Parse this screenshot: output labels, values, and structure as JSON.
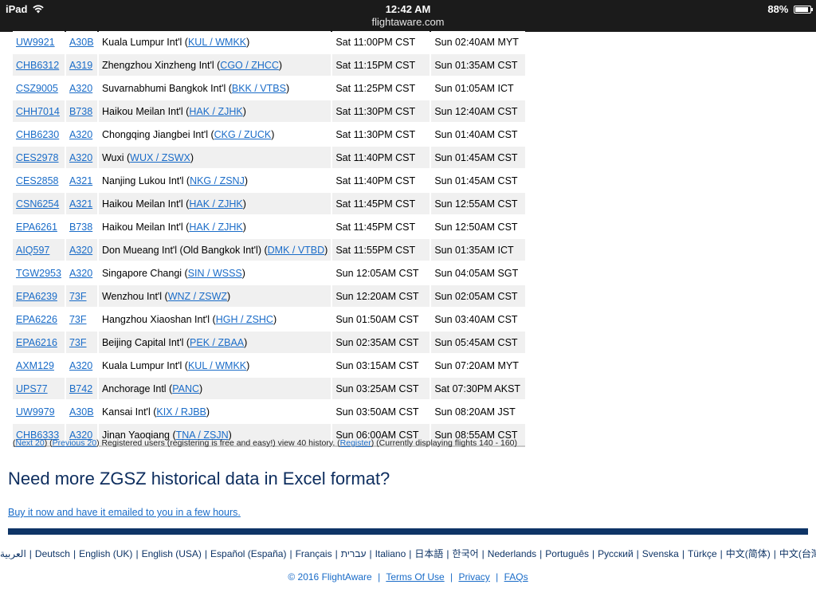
{
  "status_bar": {
    "device": "iPad",
    "time": "12:42 AM",
    "url": "flightaware.com",
    "battery": "88%",
    "battery_level": 0.88
  },
  "flights": [
    {
      "ident": "UW9921",
      "aircraft": "A30B",
      "origin_name": "Kuala Lumpur Int'l (",
      "origin_code": "KUL / WMKK",
      "origin_close": ")",
      "departure": "Sat 11:00PM CST",
      "arrival": "Sun 02:40AM MYT"
    },
    {
      "ident": "CHB6312",
      "aircraft": "A319",
      "origin_name": "Zhengzhou Xinzheng Int'l (",
      "origin_code": "CGO / ZHCC",
      "origin_close": ")",
      "departure": "Sat 11:15PM CST",
      "arrival": "Sun 01:35AM CST"
    },
    {
      "ident": "CSZ9005",
      "aircraft": "A320",
      "origin_name": "Suvarnabhumi Bangkok Int'l (",
      "origin_code": "BKK / VTBS",
      "origin_close": ")",
      "departure": "Sat 11:25PM CST",
      "arrival": "Sun 01:05AM ICT"
    },
    {
      "ident": "CHH7014",
      "aircraft": "B738",
      "origin_name": "Haikou Meilan Int'l (",
      "origin_code": "HAK / ZJHK",
      "origin_close": ")",
      "departure": "Sat 11:30PM CST",
      "arrival": "Sun 12:40AM CST"
    },
    {
      "ident": "CHB6230",
      "aircraft": "A320",
      "origin_name": "Chongqing Jiangbei Int'l (",
      "origin_code": "CKG / ZUCK",
      "origin_close": ")",
      "departure": "Sat 11:30PM CST",
      "arrival": "Sun 01:40AM CST"
    },
    {
      "ident": "CES2978",
      "aircraft": "A320",
      "origin_name": "Wuxi (",
      "origin_code": "WUX / ZSWX",
      "origin_close": ")",
      "departure": "Sat 11:40PM CST",
      "arrival": "Sun 01:45AM CST"
    },
    {
      "ident": "CES2858",
      "aircraft": "A321",
      "origin_name": "Nanjing Lukou Int'l (",
      "origin_code": "NKG / ZSNJ",
      "origin_close": ")",
      "departure": "Sat 11:40PM CST",
      "arrival": "Sun 01:45AM CST"
    },
    {
      "ident": "CSN6254",
      "aircraft": "A321",
      "origin_name": "Haikou Meilan Int'l (",
      "origin_code": "HAK / ZJHK",
      "origin_close": ")",
      "departure": "Sat 11:45PM CST",
      "arrival": "Sun 12:55AM CST"
    },
    {
      "ident": "EPA6261",
      "aircraft": "B738",
      "origin_name": "Haikou Meilan Int'l (",
      "origin_code": "HAK / ZJHK",
      "origin_close": ")",
      "departure": "Sat 11:45PM CST",
      "arrival": "Sun 12:50AM CST"
    },
    {
      "ident": "AIQ597",
      "aircraft": "A320",
      "origin_name": "Don Mueang Int'l (Old Bangkok Int'l) (",
      "origin_code": "DMK / VTBD",
      "origin_close": ")",
      "departure": "Sat 11:55PM CST",
      "arrival": "Sun 01:35AM ICT"
    },
    {
      "ident": "TGW2953",
      "aircraft": "A320",
      "origin_name": "Singapore Changi (",
      "origin_code": "SIN / WSSS",
      "origin_close": ")",
      "departure": "Sun 12:05AM CST",
      "arrival": "Sun 04:05AM SGT"
    },
    {
      "ident": "EPA6239",
      "aircraft": "73F",
      "origin_name": "Wenzhou Int'l (",
      "origin_code": "WNZ / ZSWZ",
      "origin_close": ")",
      "departure": "Sun 12:20AM CST",
      "arrival": "Sun 02:05AM CST"
    },
    {
      "ident": "EPA6226",
      "aircraft": "73F",
      "origin_name": "Hangzhou Xiaoshan Int'l (",
      "origin_code": "HGH / ZSHC",
      "origin_close": ")",
      "departure": "Sun 01:50AM CST",
      "arrival": "Sun 03:40AM CST"
    },
    {
      "ident": "EPA6216",
      "aircraft": "73F",
      "origin_name": "Beijing Capital Int'l (",
      "origin_code": "PEK / ZBAA",
      "origin_close": ")",
      "departure": "Sun 02:35AM CST",
      "arrival": "Sun 05:45AM CST"
    },
    {
      "ident": "AXM129",
      "aircraft": "A320",
      "origin_name": "Kuala Lumpur Int'l (",
      "origin_code": "KUL / WMKK",
      "origin_close": ")",
      "departure": "Sun 03:15AM CST",
      "arrival": "Sun 07:20AM MYT"
    },
    {
      "ident": "UPS77",
      "aircraft": "B742",
      "origin_name": "Anchorage Intl (",
      "origin_code": "PANC",
      "origin_close": ")",
      "departure": "Sun 03:25AM CST",
      "arrival": "Sat 07:30PM AKST"
    },
    {
      "ident": "UW9979",
      "aircraft": "A30B",
      "origin_name": "Kansai Int'l (",
      "origin_code": "KIX / RJBB",
      "origin_close": ")",
      "departure": "Sun 03:50AM CST",
      "arrival": "Sun 08:20AM JST"
    },
    {
      "ident": "CHB6333",
      "aircraft": "A320",
      "origin_name": "Jinan Yaoqiang (",
      "origin_code": "TNA / ZSJN",
      "origin_close": ")",
      "departure": "Sun 06:00AM CST",
      "arrival": "Sun 08:55AM CST"
    }
  ],
  "pager": {
    "open1": "(",
    "next": "Next 20",
    "mid": ") (",
    "previous": "Previous 20",
    "text": ") Registered users (registering is free and easy!) view 40 history. (",
    "register": "Register",
    "tail": ") (Currently displaying flights 140 - 160)"
  },
  "excel": {
    "title": "Need more ZGSZ historical data in Excel format?",
    "buy_link": "Buy it now and have it emailed to you in a few hours."
  },
  "languages": [
    "العربية",
    "Deutsch",
    "English (UK)",
    "English (USA)",
    "Español (España)",
    "Français",
    "עברית",
    "Italiano",
    "日本語",
    "한국어",
    "Nederlands",
    "Português",
    "Русский",
    "Svenska",
    "Türkçe",
    "中文(简体)",
    "中文(台灣)"
  ],
  "language_separator": "|",
  "footer": {
    "copyright": "© 2016 FlightAware",
    "terms": "Terms Of Use",
    "privacy": "Privacy",
    "faqs": "FAQs",
    "separator": "|"
  },
  "colors": {
    "link": "#1a6cc8",
    "heading": "#0d2d5e",
    "divider": "#0e3466",
    "row_alt": "#f0f0f0",
    "status_bar": "#1b1b1b"
  }
}
